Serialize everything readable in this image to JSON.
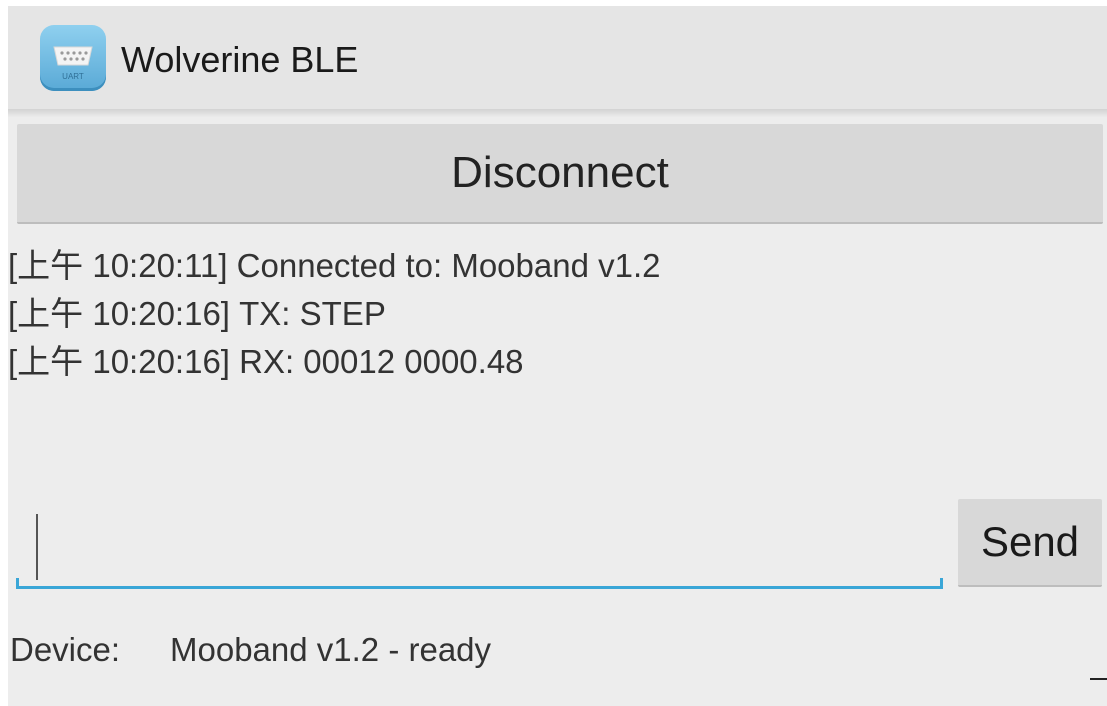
{
  "app": {
    "title": "Wolverine BLE",
    "icon": "uart-connector-icon",
    "icon_caption": "UART"
  },
  "controls": {
    "disconnect_label": "Disconnect",
    "send_label": "Send",
    "message_input_value": ""
  },
  "log": [
    "[上午 10:20:11] Connected to: Mooband v1.2",
    "[上午 10:20:16] TX: STEP",
    "[上午 10:20:16] RX: 00012  0000.48"
  ],
  "device": {
    "label": "Device:",
    "status": "Mooband v1.2 - ready"
  },
  "colors": {
    "accent": "#3aa6d7",
    "background": "#ededed",
    "button": "#d8d8d8"
  }
}
